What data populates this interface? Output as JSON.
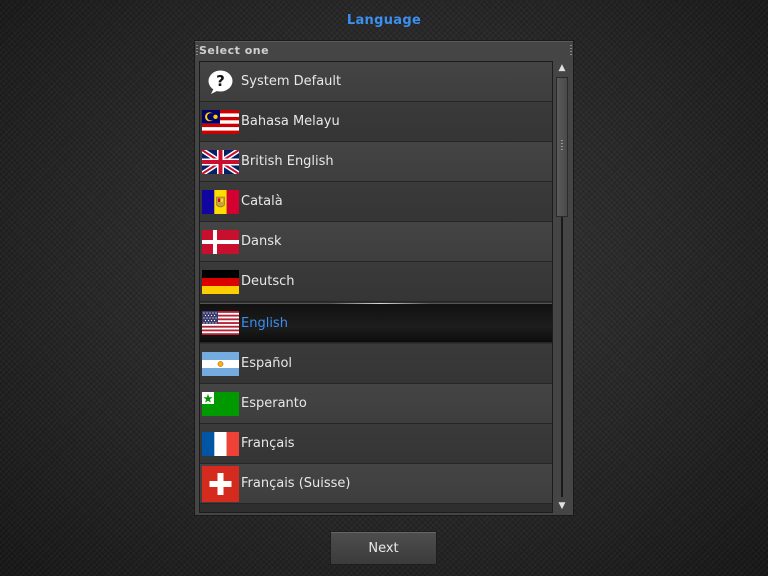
{
  "title": "Language",
  "list_header": "Select one",
  "languages": [
    {
      "label": "System Default",
      "icon": "question-bubble-icon"
    },
    {
      "label": "Bahasa Melayu",
      "icon": "malaysia-flag-icon"
    },
    {
      "label": "British English",
      "icon": "uk-flag-icon"
    },
    {
      "label": "Català",
      "icon": "andorra-flag-icon"
    },
    {
      "label": "Dansk",
      "icon": "denmark-flag-icon"
    },
    {
      "label": "Deutsch",
      "icon": "germany-flag-icon"
    },
    {
      "label": "English",
      "icon": "usa-flag-icon",
      "selected": true
    },
    {
      "label": "Español",
      "icon": "argentina-flag-icon"
    },
    {
      "label": "Esperanto",
      "icon": "esperanto-flag-icon"
    },
    {
      "label": "Français",
      "icon": "france-flag-icon"
    },
    {
      "label": "Français (Suisse)",
      "icon": "switzerland-flag-icon"
    }
  ],
  "next_label": "Next",
  "colors": {
    "accent": "#3b8ff0",
    "selected_text": "#3a8fef"
  }
}
